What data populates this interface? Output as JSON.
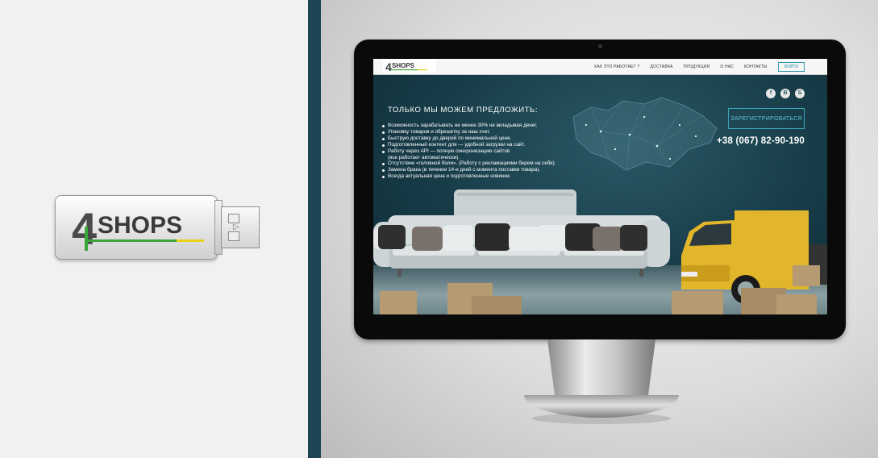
{
  "brand": {
    "logo_digit": "4",
    "logo_text": "SHOPS",
    "colors": {
      "stripe": "#1d4452",
      "accent": "#2c96a8",
      "logo_green": "#3aa63a",
      "logo_yellow": "#e8d21b"
    }
  },
  "website": {
    "nav": {
      "items": [
        "КАК ЭТО РАБОТАЕТ ?",
        "ДОСТАВКА",
        "ПРОДУКЦИЯ",
        "О НАС",
        "КОНТАКТЫ"
      ],
      "login_label": "ВОЙТИ"
    },
    "hero": {
      "title": "ТОЛЬКО МЫ МОЖЕМ ПРЕДЛОЖИТЬ:",
      "bullets": [
        "Возможность зарабатывать не менее 30% не вкладывая денег.",
        "Упаковку товаров и обрешетку за наш счет.",
        "Быструю доставку до дверей по минимальной цене.",
        "Подготовленный контент для — удобной загрузки на сайт.",
        "Работу через API — полную синхронизацию сайтов\n(все работает автоматически).",
        "Отсутствие «головной боли». (Работу с рекламациями берем на себя).",
        "Замена брака (в течении 14-и дней с момента поставки товара).",
        "Всегда актуальная цена и подготовленные новинки."
      ],
      "socials": [
        {
          "icon": "facebook-icon",
          "glyph": "f"
        },
        {
          "icon": "vk-icon",
          "glyph": "В"
        },
        {
          "icon": "skype-icon",
          "glyph": "S"
        }
      ],
      "register_label": "ЗАРЕГИСТРИРОВАТЬСЯ",
      "phone": "+38 (067) 82-90-190"
    }
  }
}
